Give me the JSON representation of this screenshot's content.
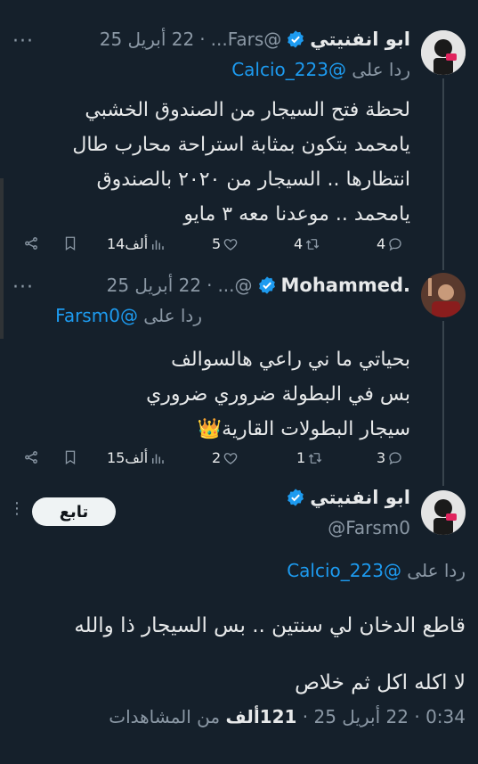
{
  "tweets": [
    {
      "name": "ابو انفنيتي",
      "handle": "@Fars...",
      "date": "22 أبريل 25",
      "reply_label": "ردا على",
      "reply_to": "@Calcio_223",
      "lines": [
        "لحظة فتح السيجار من الصندوق الخشبي",
        "يامحمد بتكون بمثابة استراحة محارب طال",
        "انتظارها .. السيجار من ٢٠٢٠ بالصندوق",
        "يامحمد .. موعدنا معه ٣ مايو"
      ],
      "replies": "4",
      "retweets": "4",
      "likes": "5",
      "views": "14ألف"
    },
    {
      "name": "Mohammed.",
      "handle": "@...",
      "date": "22 أبريل 25",
      "reply_label": "ردا على",
      "reply_to": "@Farsm0",
      "lines": [
        "بحياتي ما ني راعي هالسوالف",
        "بس في البطولة ضروري ضروري",
        "سيجار البطولات القارية👑"
      ],
      "replies": "3",
      "retweets": "1",
      "likes": "2",
      "views": "15ألف"
    }
  ],
  "main": {
    "name": "ابو انفنيتي",
    "handle": "@Farsm0",
    "follow_label": "تابع",
    "reply_label": "ردا على",
    "reply_to": "@Calcio_223",
    "lines": [
      "قاطع الدخان لي سنتين .. بس السيجار ذا والله",
      "لا اكله اكل ثم خلاص"
    ],
    "time": "0:34",
    "date": "22 أبريل 25",
    "views_count": "121",
    "views_unit": "ألف",
    "views_label": "من المشاهدات"
  },
  "colors": {
    "background": "#15202b",
    "text": "#e7e9ea",
    "secondary": "#8b98a5",
    "accent": "#1d9bf0"
  },
  "icons": [
    "verified-badge-icon",
    "reply-icon",
    "retweet-icon",
    "like-icon",
    "views-icon",
    "bookmark-icon",
    "share-icon",
    "more-icon"
  ]
}
